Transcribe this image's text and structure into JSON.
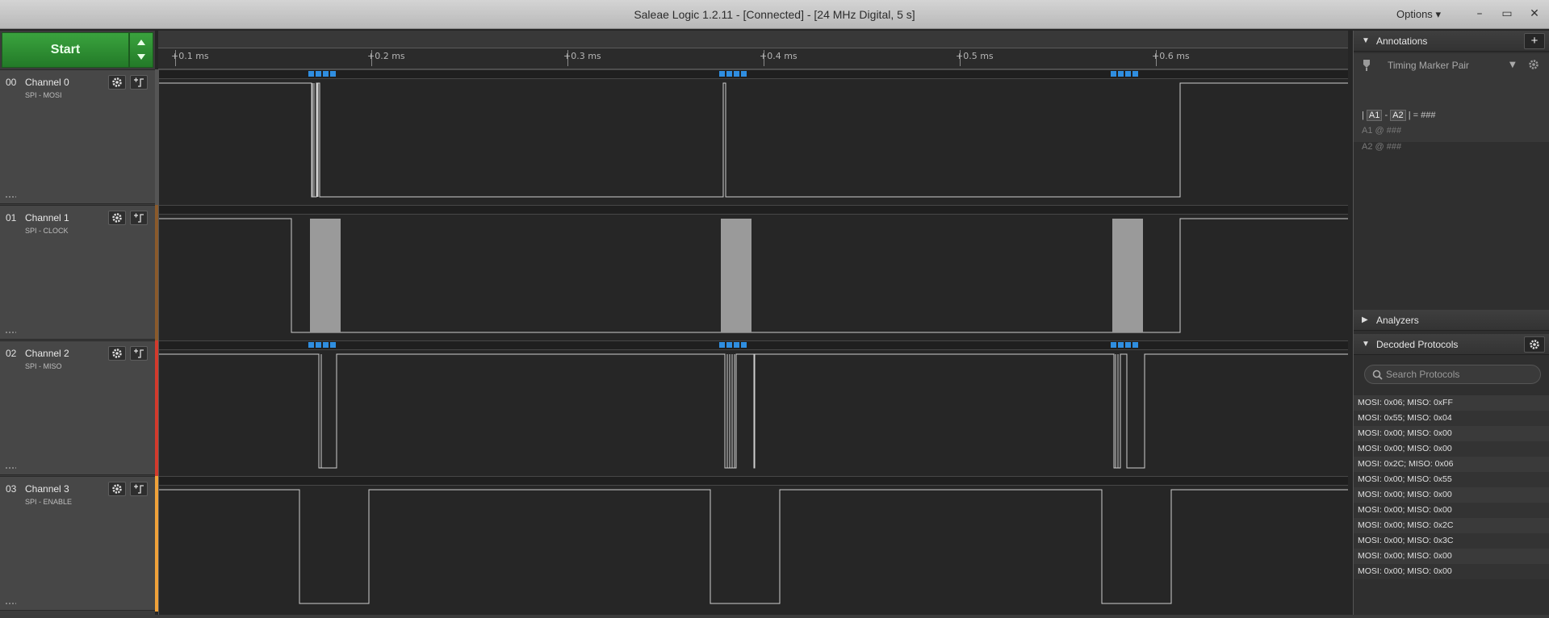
{
  "window": {
    "title": "Saleae Logic 1.2.11 - [Connected] - [24 MHz Digital, 5 s]",
    "options_label": "Options",
    "minimize": "–",
    "restore": "▭",
    "close": "✕"
  },
  "toolbar": {
    "start_label": "Start"
  },
  "ruler": {
    "ticks": [
      "+0.1 ms",
      "+0.2 ms",
      "+0.3 ms",
      "+0.4 ms",
      "+0.5 ms",
      "+0.6 ms"
    ]
  },
  "channels": [
    {
      "num": "00",
      "name": "Channel 0",
      "sub": "SPI - MOSI",
      "color": "#555555"
    },
    {
      "num": "01",
      "name": "Channel 1",
      "sub": "SPI - CLOCK",
      "color": "#8a5a2b"
    },
    {
      "num": "02",
      "name": "Channel 2",
      "sub": "SPI - MISO",
      "color": "#d33a2c"
    },
    {
      "num": "03",
      "name": "Channel 3",
      "sub": "SPI - ENABLE",
      "color": "#f0a23a"
    }
  ],
  "annotations": {
    "header": "Annotations",
    "marker_type": "Timing Marker Pair",
    "formula": {
      "a1": "A1",
      "a2": "A2",
      "value": "= ###"
    },
    "a1_line": "A1  @  ###",
    "a2_line": "A2  @  ###"
  },
  "analyzers": {
    "header": "Analyzers"
  },
  "decoded": {
    "header": "Decoded Protocols",
    "search_placeholder": "Search Protocols",
    "rows": [
      "MOSI: 0x06;  MISO: 0xFF",
      "MOSI: 0x55;  MISO: 0x04",
      "MOSI: 0x00;  MISO: 0x00",
      "MOSI: 0x00;  MISO: 0x00",
      "MOSI: 0x2C;  MISO: 0x06",
      "MOSI: 0x00;  MISO: 0x55",
      "MOSI: 0x00;  MISO: 0x00",
      "MOSI: 0x00;  MISO: 0x00",
      "MOSI: 0x00;  MISO: 0x2C",
      "MOSI: 0x00;  MISO: 0x3C",
      "MOSI: 0x00;  MISO: 0x00",
      "MOSI: 0x00;  MISO: 0x00"
    ]
  },
  "colors": {
    "decode_marker": "#2f8ee0",
    "trace": "#cfcfcf",
    "burst_fill": "#9a9a9a"
  }
}
